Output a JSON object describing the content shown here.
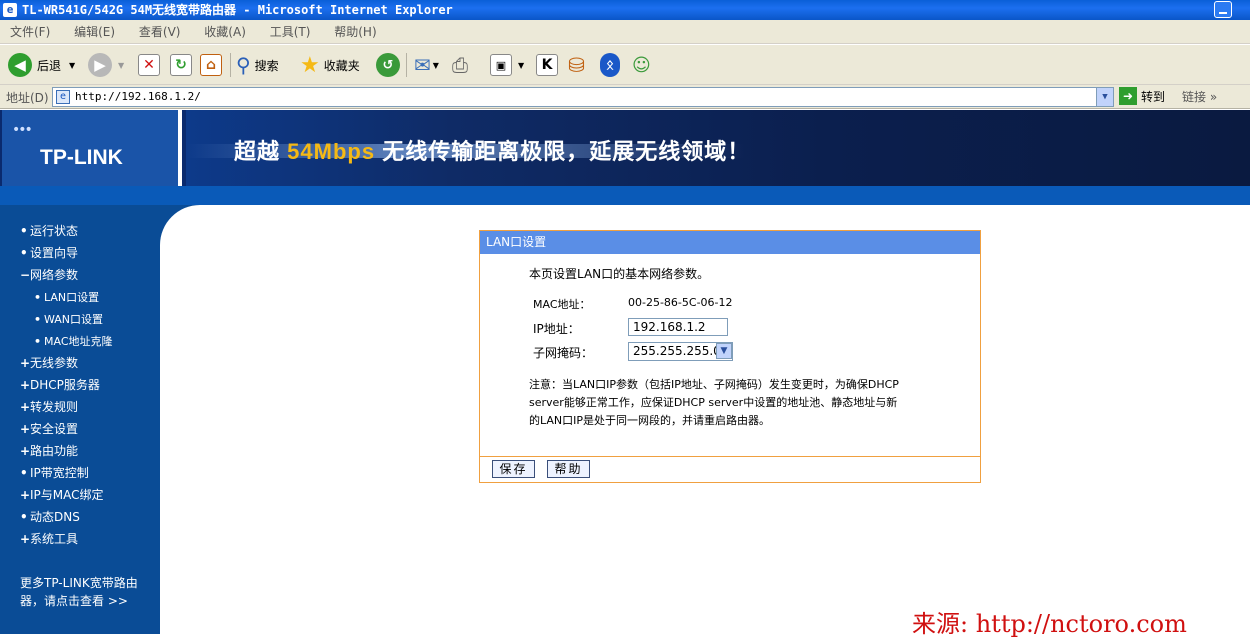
{
  "window": {
    "title": "TL-WR541G/542G 54M无线宽带路由器 - Microsoft Internet Explorer"
  },
  "menu": [
    "文件(F)",
    "编辑(E)",
    "查看(V)",
    "收藏(A)",
    "工具(T)",
    "帮助(H)"
  ],
  "toolbar": {
    "back": "后退",
    "search": "搜索",
    "favorites": "收藏夹"
  },
  "address": {
    "label": "地址(D)",
    "url": "http://192.168.1.2/",
    "go": "转到",
    "links": "链接"
  },
  "banner": {
    "logo": "TP-LINK",
    "slogan_a": "超越",
    "slogan_hl": "54Mbps",
    "slogan_b": "无线传输距离极限，延展无线领域！"
  },
  "sidebar": {
    "items": [
      {
        "mark": "•",
        "label": "运行状态"
      },
      {
        "mark": "•",
        "label": "设置向导"
      },
      {
        "mark": "−",
        "label": "网络参数"
      },
      {
        "mark": "•",
        "label": "LAN口设置"
      },
      {
        "mark": "•",
        "label": "WAN口设置"
      },
      {
        "mark": "•",
        "label": "MAC地址克隆"
      },
      {
        "mark": "+",
        "label": "无线参数"
      },
      {
        "mark": "+",
        "label": "DHCP服务器"
      },
      {
        "mark": "+",
        "label": "转发规则"
      },
      {
        "mark": "+",
        "label": "安全设置"
      },
      {
        "mark": "+",
        "label": "路由功能"
      },
      {
        "mark": "•",
        "label": "IP带宽控制"
      },
      {
        "mark": "+",
        "label": "IP与MAC绑定"
      },
      {
        "mark": "•",
        "label": "动态DNS"
      },
      {
        "mark": "+",
        "label": "系统工具"
      }
    ],
    "more": "更多TP-LINK宽带路由器，请点击查看 >>"
  },
  "panel": {
    "title": "LAN口设置",
    "intro": "本页设置LAN口的基本网络参数。",
    "mac_label": "MAC地址：",
    "mac_value": "00-25-86-5C-06-12",
    "ip_label": "IP地址：",
    "ip_value": "192.168.1.2",
    "mask_label": "子网掩码：",
    "mask_value": "255.255.255.0",
    "note_1": "注意：当LAN口IP参数（包括IP地址、子网掩码）发生变更时，为确保DHCP",
    "note_2": "server能够正常工作，应保证DHCP server中设置的地址池、静态地址与新",
    "note_3": "的LAN口IP是处于同一网段的，并请重启路由器。",
    "save": "保存",
    "help": "帮助"
  },
  "watermark": "来源: http://nctoro.com"
}
